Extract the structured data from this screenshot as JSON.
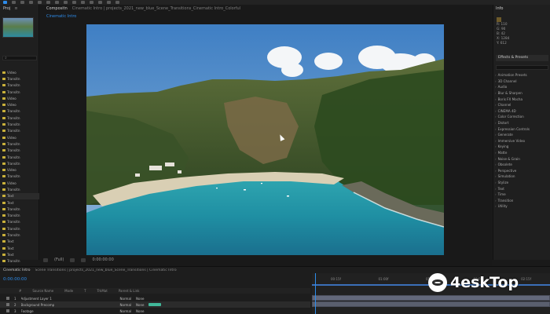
{
  "menubar": {
    "tools": [
      "selection-tool",
      "hand-tool",
      "zoom-tool",
      "rotate-tool",
      "camera-tool",
      "pan-tool",
      "rect-tool",
      "pen-tool",
      "type-tool",
      "brush-tool",
      "clone-tool",
      "eraser-tool",
      "roto-tool",
      "puppet-tool"
    ]
  },
  "project_panel": {
    "tab_label": "Proj",
    "close_label": "≡",
    "items": [
      "Video",
      "Transitn",
      "Transitn",
      "Transitn",
      "Video",
      "Video",
      "Transitn",
      "Transitn",
      "Transitn",
      "Transitn",
      "Video",
      "Transitn",
      "Transitn",
      "Transitn",
      "Transitn",
      "Video",
      "Transitn",
      "Video",
      "Transitn",
      "Text",
      "Text",
      "Transitn",
      "Transitn",
      "Transitn",
      "Transitn",
      "Transitn",
      "Text",
      "Text",
      "Text",
      "Transitn"
    ]
  },
  "viewer": {
    "comp_tab": "Compositn",
    "comp_path": "Cinematic Intro | projects_2021_new_blue_Scene_Transitions_Cinematic Intro_Colorful",
    "crumb": "Cinematic Intro",
    "footer": {
      "zoom": "(Full)",
      "timecode": "0:00:00:00"
    }
  },
  "info_panel": {
    "tab_label": "Info",
    "lines": [
      "R: 110",
      "G: 90",
      "B: 42",
      "X: 1284",
      "Y: 612"
    ]
  },
  "effects_panel": {
    "tab_label": "Effects & Presets",
    "items": [
      "Animation Presets",
      "3D Channel",
      "Audio",
      "Blur & Sharpen",
      "Boris FX Mocha",
      "Channel",
      "CINEMA 4D",
      "Color Correction",
      "Distort",
      "Expression Controls",
      "Generate",
      "Immersive Video",
      "Keying",
      "Matte",
      "Noise & Grain",
      "Obsolete",
      "Perspective",
      "Simulation",
      "Stylize",
      "Text",
      "Time",
      "Transition",
      "Utility"
    ]
  },
  "timeline": {
    "tab_label": "Cinematic Intro",
    "tab_path": "Scene Transitions | projects_2021_new_blue_Scene_Transitions | Cinematic Intro",
    "timecode": "0:00:00:00",
    "header": [
      "#",
      "Source Name",
      "Mode",
      "T",
      "TrkMat",
      "Parent & Link"
    ],
    "rows": [
      {
        "index": "1",
        "name": "Adjustment Layer 1",
        "mode": "Normal",
        "parent": "None"
      },
      {
        "index": "2",
        "name": "Background Precomp",
        "mode": "Normal",
        "parent": "None"
      },
      {
        "index": "3",
        "name": "Footage",
        "mode": "Normal",
        "parent": "None"
      }
    ],
    "ruler_marks": [
      "00:15f",
      "01:00f",
      "01:15f",
      "02:00f",
      "02:15f"
    ]
  },
  "watermark": {
    "text": "4eskTop"
  },
  "colors": {
    "accent": "#2d8ceb",
    "folder": "#c9b03a",
    "green_chip": "#41b89a",
    "layer_bar": "#63687a"
  }
}
